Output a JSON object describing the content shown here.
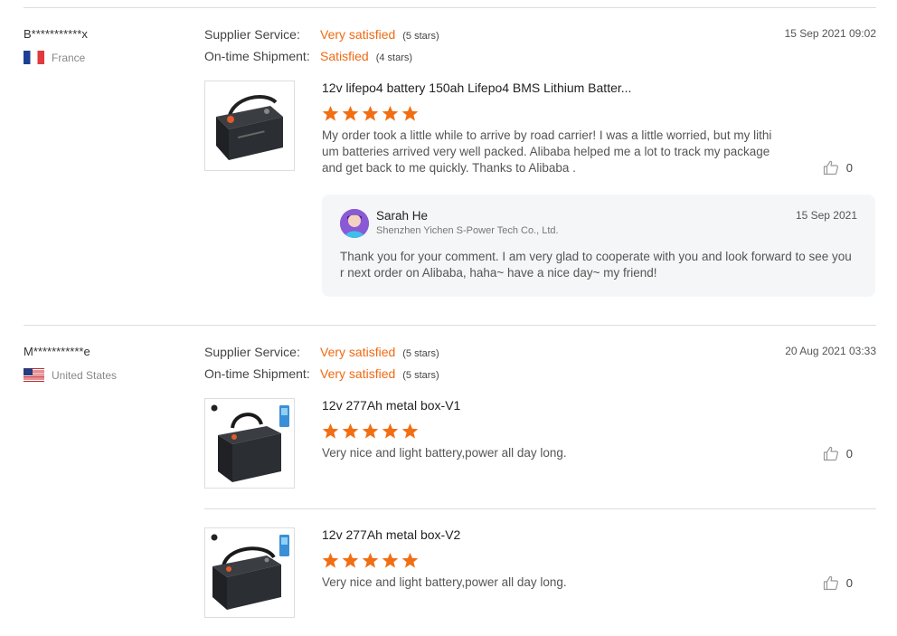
{
  "reviews": [
    {
      "buyer": "B***********x",
      "country": "France",
      "supplier_service_label": "Supplier Service:",
      "supplier_service_value": "Very satisfied",
      "supplier_service_stars": "(5 stars)",
      "shipment_label": "On-time Shipment:",
      "shipment_value": "Satisfied",
      "shipment_stars": "(4 stars)",
      "date": "15 Sep 2021 09:02",
      "products": [
        {
          "title": "12v lifepo4 battery 150ah Lifepo4 BMS Lithium Batter...",
          "rating": 5,
          "comment": "My order took a little while to arrive by road carrier! I was a little worried, but my lithium batteries arrived very well packed. Alibaba helped me a lot to track my package and get back to me quickly. Thanks to Alibaba .",
          "likes": "0"
        }
      ],
      "reply": {
        "name": "Sarah He",
        "company": "Shenzhen Yichen S-Power Tech Co., Ltd.",
        "date": "15 Sep 2021",
        "text": "Thank you for your comment. I am very glad to cooperate with you and look forward to see your next order on Alibaba, haha~ have a nice day~ my friend!"
      }
    },
    {
      "buyer": "M***********e",
      "country": "United States",
      "supplier_service_label": "Supplier Service:",
      "supplier_service_value": "Very satisfied",
      "supplier_service_stars": "(5 stars)",
      "shipment_label": "On-time Shipment:",
      "shipment_value": "Very satisfied",
      "shipment_stars": "(5 stars)",
      "date": "20 Aug 2021 03:33",
      "products": [
        {
          "title": "12v 277Ah metal box-V1",
          "rating": 5,
          "comment": "Very nice and light battery,power all day long.",
          "likes": "0"
        },
        {
          "title": "12v 277Ah metal box-V2",
          "rating": 5,
          "comment": "Very nice and light battery,power all day long.",
          "likes": "0"
        }
      ]
    }
  ],
  "colors": {
    "accent": "#ef6a13",
    "star": "#f26e13",
    "divider": "#dddddd",
    "reply_bg": "#f5f6f7"
  },
  "icons": {
    "like": "thumbs-up-icon",
    "star": "star-icon"
  }
}
